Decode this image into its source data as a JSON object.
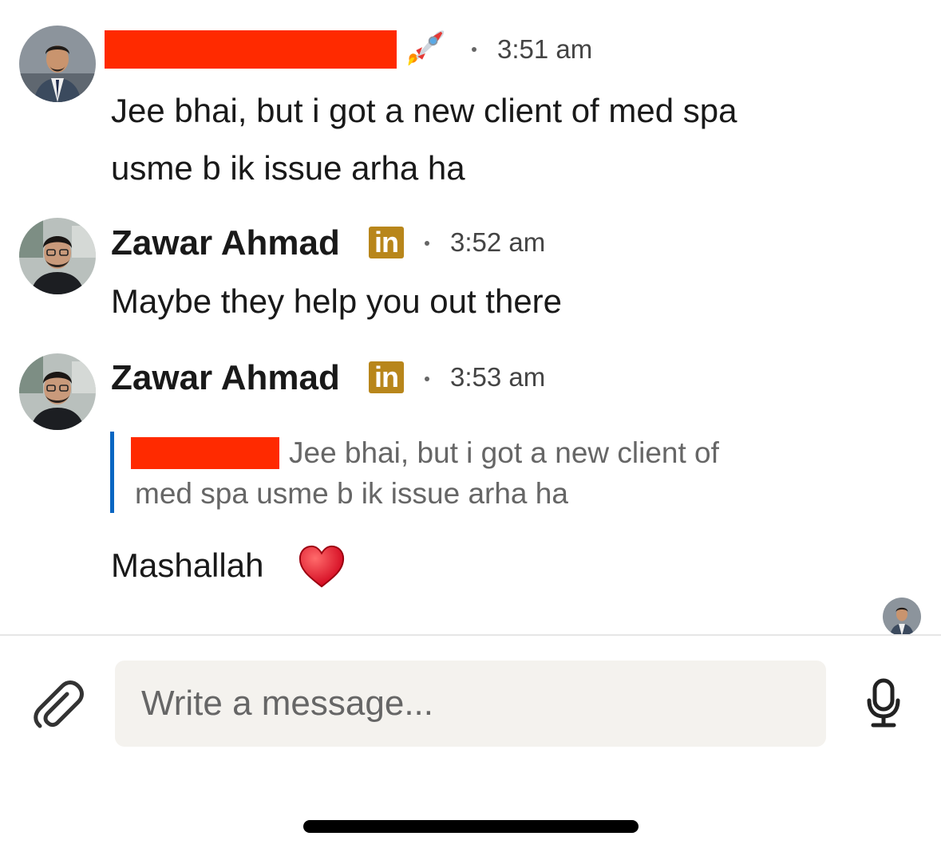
{
  "messages": [
    {
      "sender": "",
      "time": "3:51 am",
      "text_lines": [
        "Jee bhai, but i got a new client of med spa",
        "usme b ik issue arha ha"
      ]
    },
    {
      "sender": "Zawar Ahmad",
      "badge": "in",
      "time": "3:52 am",
      "text_lines": [
        "Maybe they help you out there"
      ]
    },
    {
      "sender": "Zawar Ahmad",
      "badge": "in",
      "time": "3:53 am",
      "quote": {
        "line1": "Jee bhai, but i got a new client of",
        "line2": "med spa usme b ik issue arha ha"
      },
      "text_lines": [
        "Mashallah"
      ]
    }
  ],
  "composer": {
    "placeholder": "Write a message..."
  },
  "icons": {
    "attach": "paperclip-icon",
    "mic": "microphone-icon",
    "rocket": "rocket-emoji",
    "heart": "red-heart-emoji",
    "premium": "linkedin-premium-icon"
  },
  "colors": {
    "redaction": "#ff2a00",
    "premium_badge": "#b8861b",
    "quote_bar": "#0a66c2",
    "input_bg": "#f4f2ee"
  }
}
